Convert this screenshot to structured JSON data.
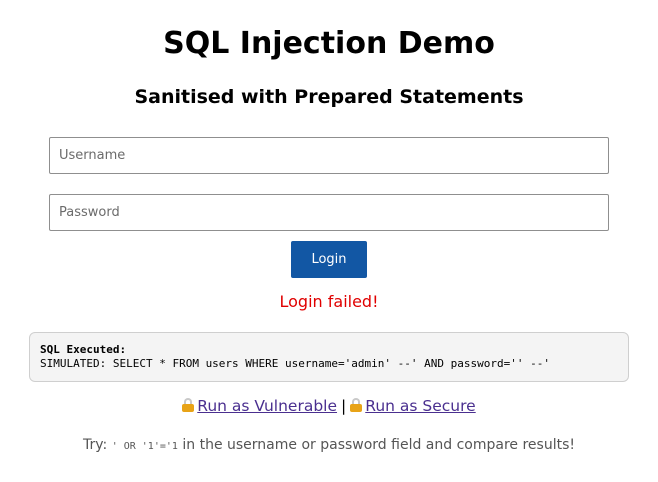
{
  "header": {
    "title": "SQL Injection Demo",
    "subtitle": "Sanitised with Prepared Statements"
  },
  "form": {
    "username_placeholder": "Username",
    "username_value": "",
    "password_placeholder": "Password",
    "password_value": "",
    "login_label": "Login"
  },
  "status": {
    "message": "Login failed!",
    "color": "#e00000"
  },
  "sql_output": {
    "label": "SQL Executed:",
    "query": "SIMULATED: SELECT * FROM users WHERE username='admin' --' AND password='' --'"
  },
  "mode_links": {
    "vulnerable_label": "Run as Vulnerable",
    "separator": "|",
    "secure_label": "Run as Secure",
    "icon": "lock-icon"
  },
  "hint": {
    "prefix": "Try:",
    "payload": "' OR '1'='1",
    "suffix": "in the username or password field and compare results!"
  },
  "colors": {
    "button": "#1257a4",
    "link": "#4a2f8f",
    "error": "#e00000"
  }
}
